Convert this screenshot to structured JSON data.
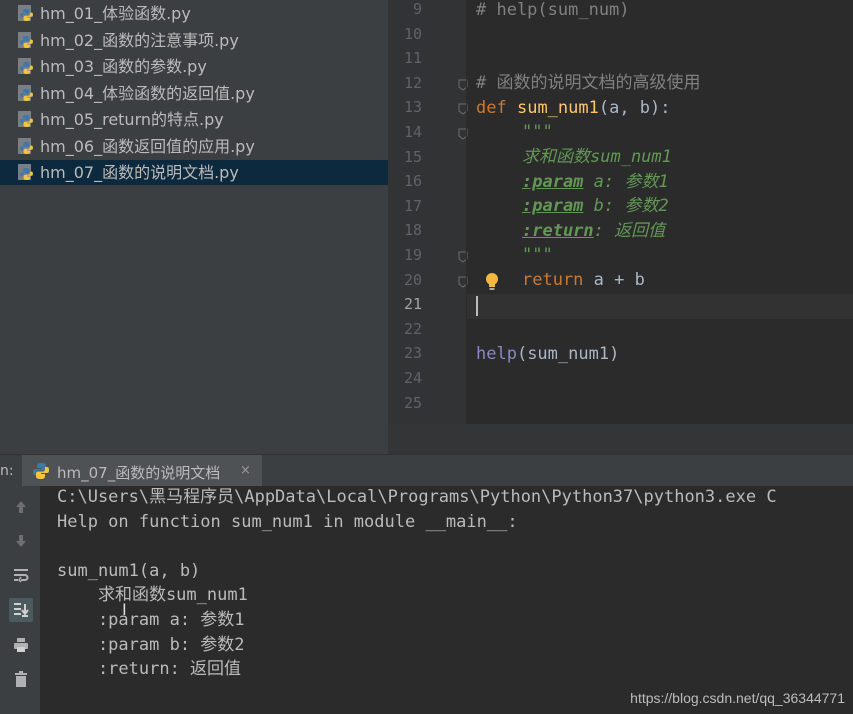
{
  "project": {
    "files": [
      {
        "name": "hm_01_体验函数.py"
      },
      {
        "name": "hm_02_函数的注意事项.py"
      },
      {
        "name": "hm_03_函数的参数.py"
      },
      {
        "name": "hm_04_体验函数的返回值.py"
      },
      {
        "name": "hm_05_return的特点.py"
      },
      {
        "name": "hm_06_函数返回值的应用.py"
      },
      {
        "name": "hm_07_函数的说明文档.py",
        "selected": true
      }
    ]
  },
  "editor": {
    "line_numbers": [
      "9",
      "10",
      "11",
      "12",
      "13",
      "14",
      "15",
      "16",
      "17",
      "18",
      "19",
      "20",
      "21",
      "22",
      "23",
      "24",
      "25"
    ],
    "current_line": "21",
    "lines": {
      "l9": "# help(sum_num)",
      "l12": "# 函数的说明文档的高级使用",
      "l13_kw": "def",
      "l13_fn": "sum_num1",
      "l13_rest": "(a, b):",
      "l14": "\"\"\"",
      "l15": "求和函数sum_num1",
      "l16_tag": ":param",
      "l16_rest": " a: 参数1",
      "l17_tag": ":param",
      "l17_rest": " b: 参数2",
      "l18_tag": ":return",
      "l18_rest": ": 返回值",
      "l19": "\"\"\"",
      "l20_kw": "return",
      "l20_rest": " a + b",
      "l23_fn": "help",
      "l23_rest": "(sum_num1)"
    }
  },
  "run": {
    "label": "n:",
    "tab_title": "hm_07_函数的说明文档",
    "close": "×",
    "output": [
      "C:\\Users\\黑马程序员\\AppData\\Local\\Programs\\Python\\Python37\\python3.exe C",
      "Help on function sum_num1 in module __main__:",
      "",
      "sum_num1(a, b)",
      "    求和函数sum_num1",
      "    :param a: 参数1",
      "    :param b: 参数2",
      "    :return: 返回值"
    ],
    "toolbar_icons": [
      "arrow-up-icon",
      "arrow-down-icon",
      "soft-wrap-icon",
      "scroll-to-end-icon",
      "print-icon",
      "trash-icon"
    ]
  },
  "watermark": "https://blog.csdn.net/qq_36344771"
}
